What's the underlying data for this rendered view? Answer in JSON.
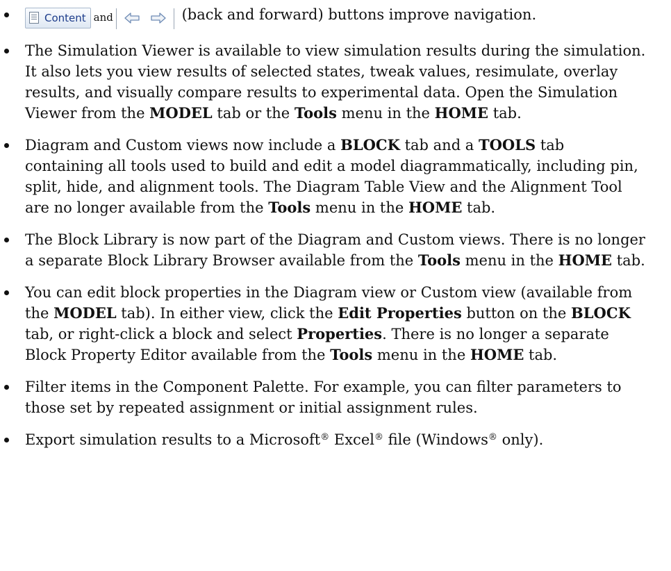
{
  "items": [
    {
      "content_button_label": "Content",
      "and_text": "and",
      "rest_text": "(back and forward) buttons improve navigation.",
      "icons": {
        "content": "document-list-icon",
        "back": "back-arrow-icon",
        "forward": "forward-arrow-icon"
      }
    },
    {
      "t1": "The Simulation Viewer is available to view simulation results during the simulation. It also lets you view results of selected states, tweak values, resimulate, overlay results, and visually compare results to experimental data. Open the Simulation Viewer from the ",
      "b1": "MODEL",
      "t2": " tab or the ",
      "b2": "Tools",
      "t3": " menu in the ",
      "b3": "HOME",
      "t4": " tab."
    },
    {
      "t1": "Diagram and Custom views now include a ",
      "b1": "BLOCK",
      "t2": " tab and a ",
      "b2": "TOOLS",
      "t3": " tab containing all tools used to build and edit a model diagrammatically, including pin, split, hide, and alignment tools. The Diagram Table View and the Alignment Tool are no longer available from the ",
      "b3": "Tools",
      "t4": " menu in the ",
      "b4": "HOME",
      "t5": " tab."
    },
    {
      "t1": "The Block Library is now part of the Diagram and Custom views. There is no longer a separate Block Library Browser available from the ",
      "b1": "Tools",
      "t2": " menu in the ",
      "b2": "HOME",
      "t3": " tab."
    },
    {
      "t1": "You can edit block properties in the Diagram view or Custom view (available from the ",
      "b1": "MODEL",
      "t2": " tab). In either view, click the ",
      "b2": "Edit Properties",
      "t3": " button on the ",
      "b3": "BLOCK",
      "t4": " tab, or right-click a block and select ",
      "b4": "Properties",
      "t5": ". There is no longer a separate Block Property Editor available from the ",
      "b5": "Tools",
      "t6": " menu in the ",
      "b6": "HOME",
      "t7": " tab."
    },
    {
      "t1": "Filter items in the Component Palette. For example, you can filter parameters to those set by repeated assignment or initial assignment rules."
    },
    {
      "t1": "Export simulation results to a Microsoft",
      "r1": "®",
      "t2": " Excel",
      "r2": "®",
      "t3": " file (Windows",
      "r3": "®",
      "t4": " only)."
    }
  ]
}
